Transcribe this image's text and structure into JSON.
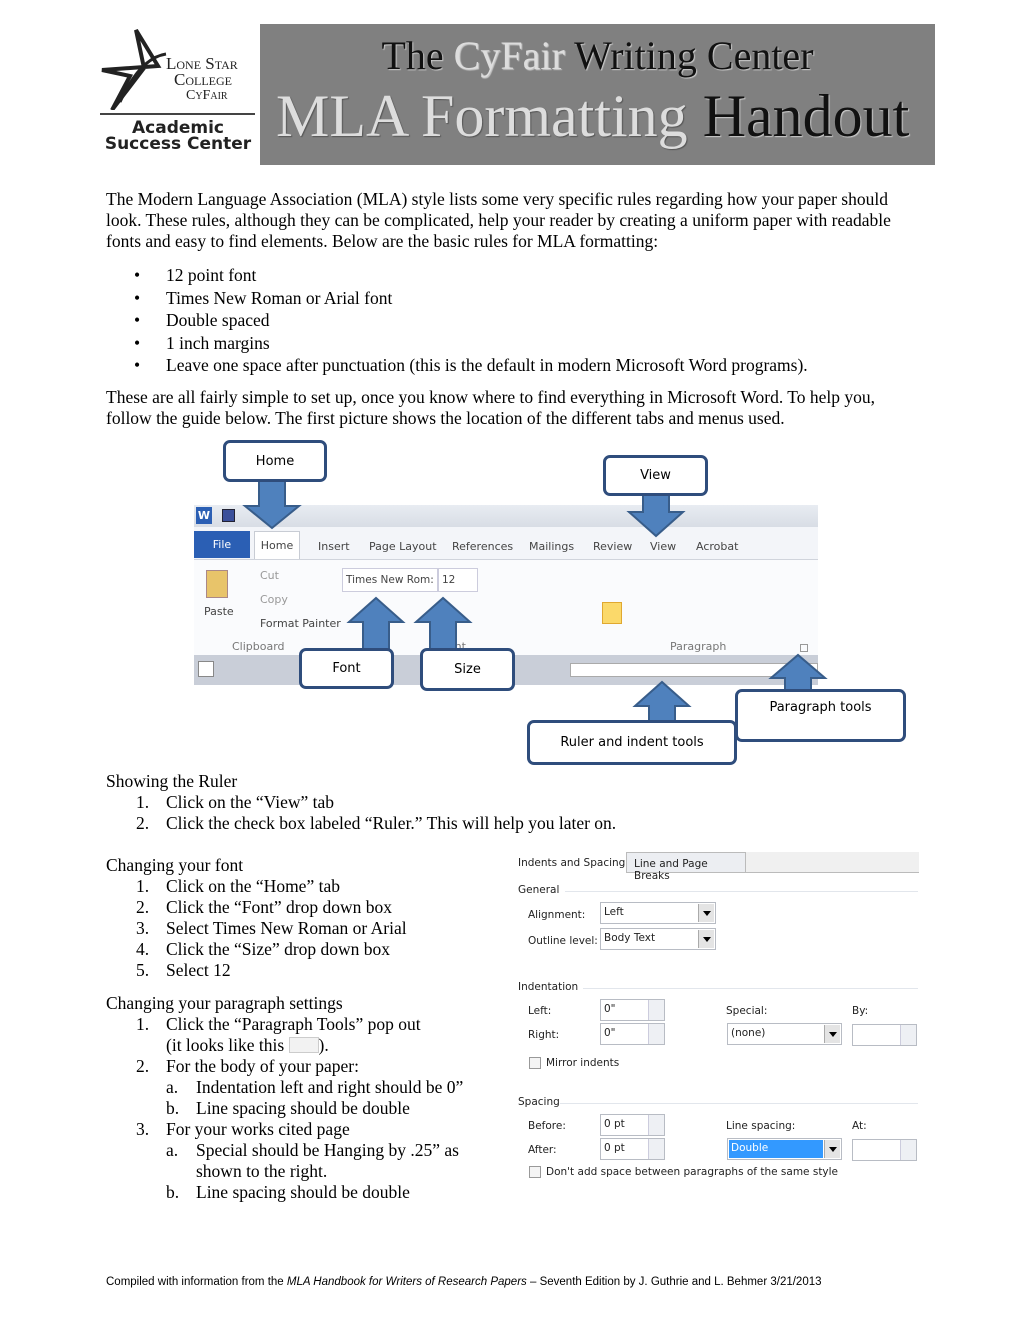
{
  "logo": {
    "line1": "Lone Star",
    "line2": "College",
    "line3": "CyFair",
    "line4": "Academic",
    "line5": "Success Center"
  },
  "banner": {
    "line1_a": "The ",
    "line1_b": "CyFair",
    "line1_c": " Writing Center",
    "line2_a": "MLA Formatting ",
    "line2_b": "Handout"
  },
  "intro": "The Modern Language Association (MLA) style lists some very specific rules regarding how your paper should look. These rules, although they can be complicated, help your reader by creating a uniform paper with readable fonts and easy to find elements. Below are the basic rules for MLA formatting:",
  "rules": [
    "12 point font",
    "Times New Roman or Arial font",
    "Double spaced",
    "1 inch margins",
    "Leave one space after punctuation (this is the default in modern Microsoft Word programs)."
  ],
  "setup": "These are all fairly simple to set up, once you know where to find everything in Microsoft Word. To help you, follow the guide below. The first picture shows the location of the different tabs and menus used.",
  "callouts": {
    "home": "Home",
    "view": "View",
    "font": "Font",
    "size": "Size",
    "paragraph_tools": "Paragraph tools",
    "ruler": "Ruler and indent tools"
  },
  "ribbon": {
    "tabs": [
      "File",
      "Home",
      "Insert",
      "Page Layout",
      "References",
      "Mailings",
      "Review",
      "View",
      "Acrobat"
    ],
    "cut": "Cut",
    "copy": "Copy",
    "paste": "Paste",
    "format_painter": "Format Painter",
    "clipboard": "Clipboard",
    "font_name": "Times New Rom:",
    "font_size": "12",
    "font_group": "Font",
    "paragraph": "Paragraph"
  },
  "ruler_section": {
    "title": "Showing the Ruler",
    "steps": [
      "Click on the “View” tab",
      "Click the check box labeled “Ruler.” This will help you later on."
    ]
  },
  "font_section": {
    "title": "Changing your font",
    "steps": [
      "Click on the “Home” tab",
      "Click the “Font” drop down box",
      "Select Times New Roman or Arial",
      "Click the “Size” drop down box",
      "Select 12"
    ]
  },
  "para_section": {
    "title": "Changing your paragraph settings",
    "s1": "Click the “Paragraph Tools” pop out",
    "s1b_a": "(it looks like this ",
    "s1b_b": ").",
    "s2": "For the body of your paper:",
    "s2a": "Indentation left and right should be 0”",
    "s2b": "Line spacing should be double",
    "s3": "For your works cited page",
    "s3a": "Special should be Hanging by .25” as",
    "s3a2": "shown to the right.",
    "s3b": "Line spacing should be double"
  },
  "dialog": {
    "tab_active": "Indents and Spacing",
    "tab_other": "Line and Page Breaks",
    "general": "General",
    "alignment_label": "Alignment:",
    "alignment": "Left",
    "outline_label": "Outline level:",
    "outline": "Body Text",
    "indentation": "Indentation",
    "left_label": "Left:",
    "left": "0\"",
    "right_label": "Right:",
    "right": "0\"",
    "special_label": "Special:",
    "special": "(none)",
    "by_label": "By:",
    "mirror": "Mirror indents",
    "spacing": "Spacing",
    "before_label": "Before:",
    "before": "0 pt",
    "after_label": "After:",
    "after": "0 pt",
    "line_spacing_label": "Line spacing:",
    "line_spacing": "Double",
    "at_label": "At:",
    "dont_add": "Don't add space between paragraphs of the same style"
  },
  "footer": {
    "a": "Compiled with information from the ",
    "b": "MLA Handbook for Writers of Research Papers",
    "c": " – Seventh Edition by J. Guthrie and L. Behmer 3/21/2013"
  },
  "colors": {
    "banner": "#808080",
    "arrow": "#4f81bd",
    "callout_border": "#2f4d7c",
    "file_tab": "#2b5fb4",
    "selection": "#3399ff"
  }
}
